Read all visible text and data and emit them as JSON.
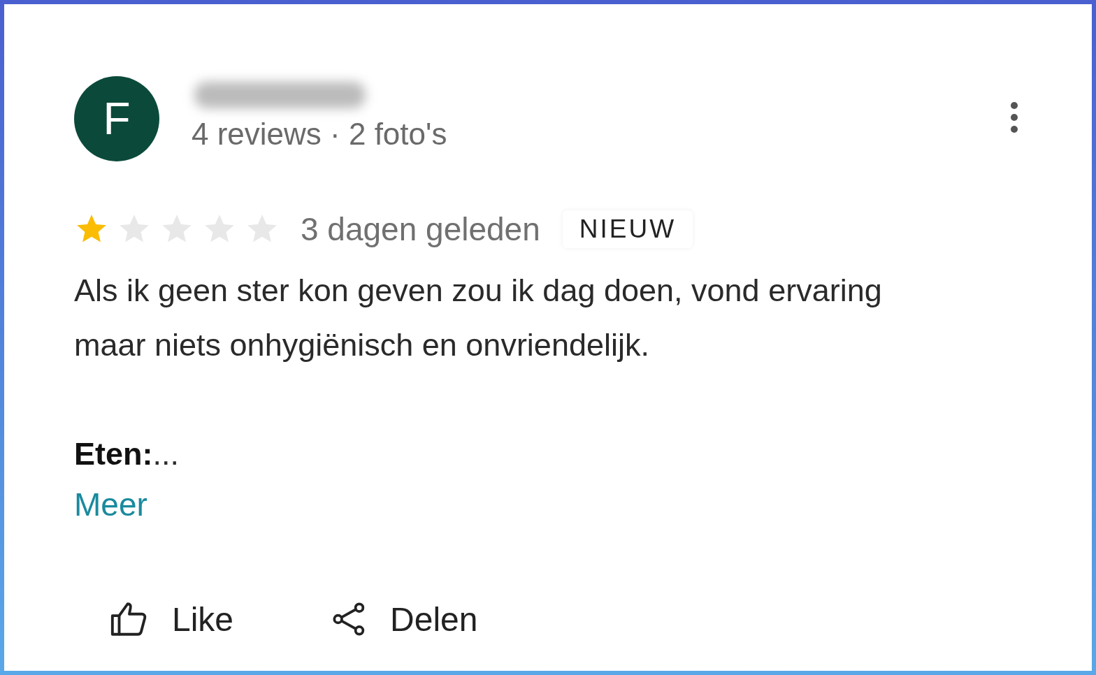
{
  "review": {
    "avatar_letter": "F",
    "meta": "4 reviews · 2 foto's",
    "stars": 1,
    "date": "3 dagen geleden",
    "badge": "NIEUW",
    "paragraphs": [
      "Als ik geen ster kon geven zou ik dag doen, vond ervaring maar niets onhygiënisch en onvriendelijk.",
      "**Eten:**..."
    ],
    "more_link": "Meer"
  },
  "actions": [
    {
      "kind": "like",
      "label": "Like"
    },
    {
      "kind": "share",
      "label": "Delen"
    }
  ]
}
